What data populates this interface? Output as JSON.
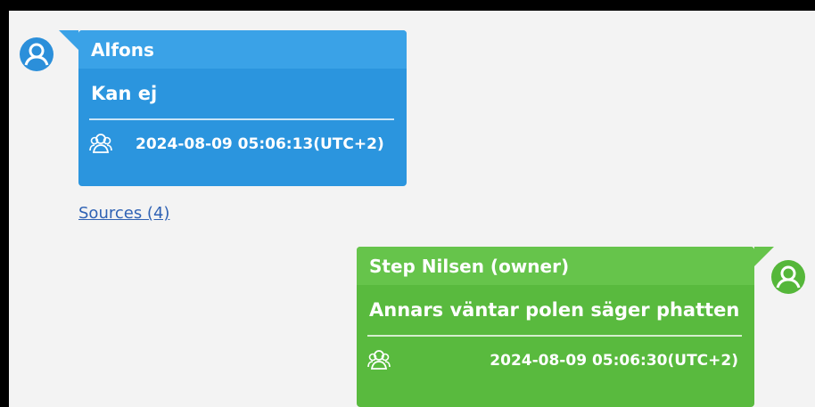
{
  "colors": {
    "incoming_bubble": "#2b95de",
    "incoming_header": "#3aa2e7",
    "outgoing_bubble": "#59ba3e",
    "outgoing_header": "#66c44b",
    "link": "#2f62b4",
    "background": "#f3f3f3"
  },
  "messages": [
    {
      "sender": "Alfons",
      "text": "Kan ej",
      "timestamp": "2024-08-09 05:06:13(UTC+2)",
      "icon": "user-circle-icon",
      "footer_icon": "group-icon"
    },
    {
      "sender": "Step Nilsen (owner)",
      "text": "Annars väntar polen säger phatten",
      "timestamp": "2024-08-09 05:06:30(UTC+2)",
      "icon": "user-circle-icon",
      "footer_icon": "group-icon"
    }
  ],
  "sources_link": "Sources (4)"
}
